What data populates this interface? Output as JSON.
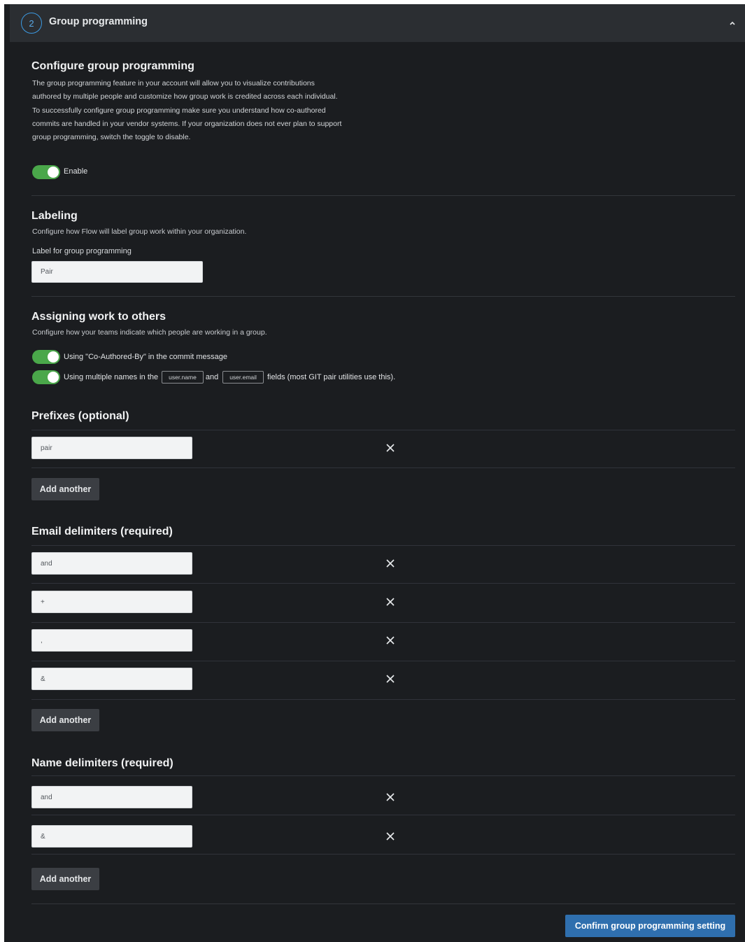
{
  "header": {
    "step_number": "2",
    "title": "Group programming"
  },
  "configure": {
    "title": "Configure group programming",
    "description": "The group programming feature in your account will allow you to visualize contributions authored by multiple people and customize how group work is credited across each individual. To successfully configure group programming make sure you understand how co-authored commits are handled in your vendor systems. If your organization does not ever plan to support group programming, switch the toggle to disable.",
    "toggle_label": "Enable",
    "enabled": true
  },
  "labeling": {
    "title": "Labeling",
    "description": "Configure how Flow will label group work within your organization.",
    "field_label": "Label for group programming",
    "field_value": "Pair"
  },
  "assigning": {
    "title": "Assigning work to others",
    "description": "Configure how your teams indicate which people are working in a group.",
    "option1_label": "Using \"Co-Authored-By\" in the commit message",
    "option1_enabled": true,
    "option2_prefix": "Using multiple names in the",
    "option2_code1": "user.name",
    "option2_and": "and",
    "option2_code2": "user.email",
    "option2_suffix": "fields (most GIT pair utilities use this).",
    "option2_enabled": true
  },
  "prefixes": {
    "title": "Prefixes (optional)",
    "items": [
      "pair"
    ],
    "add_label": "Add another"
  },
  "email_delimiters": {
    "title": "Email delimiters (required)",
    "items": [
      "and",
      "+",
      ",",
      "&"
    ],
    "add_label": "Add another"
  },
  "name_delimiters": {
    "title": "Name delimiters (required)",
    "items": [
      "and",
      "&"
    ],
    "add_label": "Add another"
  },
  "confirm_label": "Confirm group programming setting",
  "colors": {
    "background": "#1b1d20",
    "header": "#2b2e32",
    "toggle_on": "#4aa74a",
    "accent": "#2f6fae"
  }
}
